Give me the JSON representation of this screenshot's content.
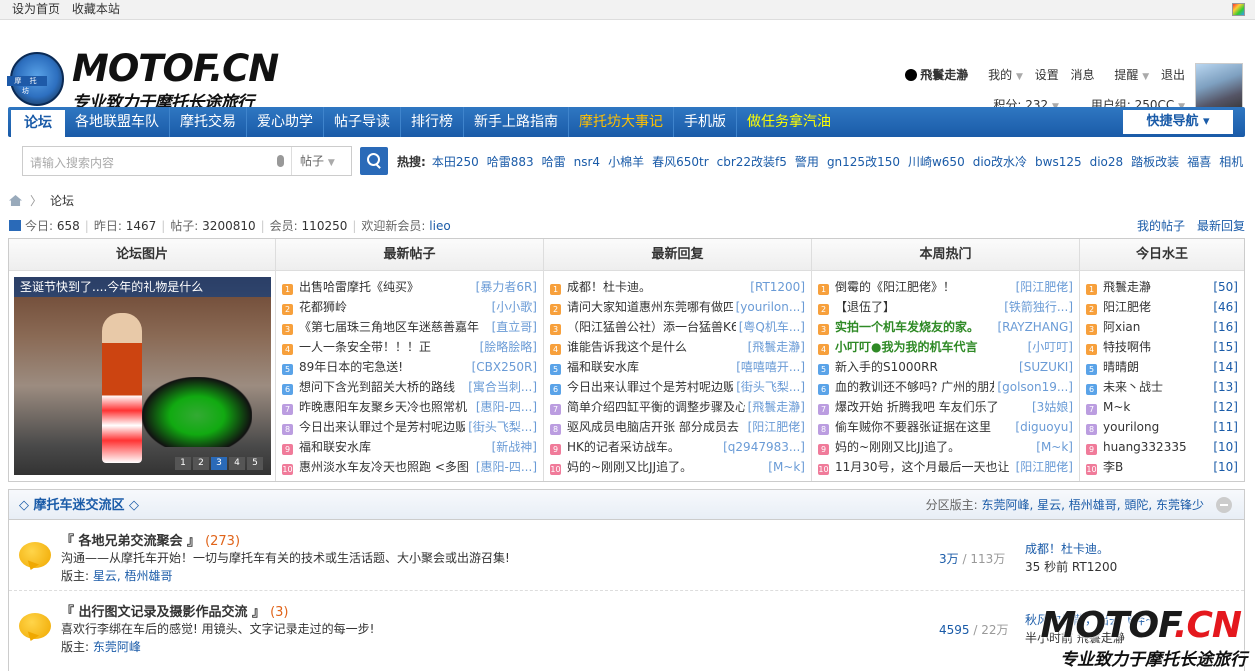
{
  "topbar": {
    "set_home": "设为首页",
    "bookmark": "收藏本站"
  },
  "logo": {
    "text": "MOTOF.CN",
    "subtitle": "专业致力于摩托长途旅行",
    "badge": "摩 托 坊"
  },
  "user": {
    "name": "飛鬟走瀞",
    "my": "我的",
    "settings": "设置",
    "messages": "消息",
    "reminders": "提醒",
    "logout": "退出",
    "points": "积分: 232",
    "group": "用户组: 250CC"
  },
  "nav": {
    "items": [
      "论坛",
      "各地联盟车队",
      "摩托交易",
      "爱心助学",
      "帖子导读",
      "排行榜",
      "新手上路指南",
      "摩托坊大事记",
      "手机版",
      "做任务拿汽油"
    ],
    "quick": "快捷导航"
  },
  "search": {
    "placeholder": "请输入搜索内容",
    "scope": "帖子",
    "hot_label": "热搜:",
    "hot": [
      "本田250",
      "哈雷883",
      "哈雷",
      "nsr4",
      "小棉羊",
      "春风650tr",
      "cbr22改装f5",
      "警用",
      "gn125改150",
      "川崎w650",
      "dio改水冷",
      "bws125",
      "dio28",
      "踏板改装",
      "福喜",
      "相机"
    ]
  },
  "breadcrumb": {
    "current": "论坛"
  },
  "stats": {
    "today_label": "今日:",
    "today": "658",
    "yesterday_label": "昨日:",
    "yesterday": "1467",
    "posts_label": "帖子:",
    "posts": "3200810",
    "members_label": "会员:",
    "members": "110250",
    "welcome_label": "欢迎新会员:",
    "new_member": "lieo",
    "my_posts": "我的帖子",
    "latest_reply": "最新回复"
  },
  "columns": {
    "pics": {
      "title": "论坛图片",
      "caption": "圣诞节快到了....今年的礼物是什么",
      "pages": [
        "1",
        "2",
        "3",
        "4",
        "5"
      ]
    },
    "newposts": {
      "title": "最新帖子",
      "items": [
        {
          "n": "1",
          "t": "出售哈雷摩托《纯买》",
          "a": "[暴力者6R]"
        },
        {
          "n": "2",
          "t": "花都狮岭",
          "a": "[小小歌]"
        },
        {
          "n": "3",
          "t": "《第七届珠三角地区车迷慈善嘉年",
          "a": "[直立哥]"
        },
        {
          "n": "4",
          "t": "一人一条安全带！！！正",
          "a": "[脍略脍略]"
        },
        {
          "n": "5",
          "t": "89年日本的宅急送!",
          "a": "[CBX250R]"
        },
        {
          "n": "6",
          "t": "想问下含光到韶关大桥的路线",
          "a": "[寓合当刺...]"
        },
        {
          "n": "7",
          "t": "昨晚惠阳车友聚乡天冷也照常机",
          "a": "[惠阳-四...]"
        },
        {
          "n": "8",
          "t": "今日出来认罪过个是芳村呢边贩",
          "a": "[街头飞梨...]"
        },
        {
          "n": "9",
          "t": "福和联安水库",
          "a": "[新战神]"
        },
        {
          "n": "10",
          "t": "惠州淡水车友冷天也照跑 <多图",
          "a": "[惠阳-四...]"
        }
      ]
    },
    "newreplies": {
      "title": "最新回复",
      "items": [
        {
          "n": "1",
          "t": "成都！杜卡迪。",
          "a": "[RT1200]"
        },
        {
          "n": "2",
          "t": "请问大家知道惠州东莞哪有做四",
          "a": "[yourilon...]"
        },
        {
          "n": "3",
          "t": "（阳江猛兽公社）添一台猛兽K6",
          "a": "[粤Q机车...]"
        },
        {
          "n": "4",
          "t": "谁能告诉我这个是什么",
          "a": "[飛鬟走瀞]"
        },
        {
          "n": "5",
          "t": "福和联安水库",
          "a": "[嘻嘻嘻开...]"
        },
        {
          "n": "6",
          "t": "今日出来认罪过个是芳村呢边贩",
          "a": "[街头飞梨...]"
        },
        {
          "n": "7",
          "t": "简单介绍四缸平衡的调整步骤及心",
          "a": "[飛鬟走瀞]"
        },
        {
          "n": "8",
          "t": "驱风成员电脑店开张 部分成员去",
          "a": "[阳江肥佬]"
        },
        {
          "n": "9",
          "t": "HK的记者采访战车。",
          "a": "[q2947983...]"
        },
        {
          "n": "10",
          "t": "妈的~刚刚又比JJ追了。",
          "a": "[M~k]"
        }
      ]
    },
    "hot": {
      "title": "本周热门",
      "items": [
        {
          "n": "1",
          "t": "倒霉的《阳江肥佬》！",
          "a": "[阳江肥佬]",
          "g": false
        },
        {
          "n": "2",
          "t": "【退伍了】",
          "a": "[铁箭独行...]",
          "g": false
        },
        {
          "n": "3",
          "t": "实拍一个机车发烧友的家。",
          "a": "[RAYZHANG]",
          "g": true
        },
        {
          "n": "4",
          "t": "小叮叮●我为我的机车代言",
          "a": "[小叮叮]",
          "g": true
        },
        {
          "n": "5",
          "t": "新入手的S1000RR",
          "a": "[SUZUKI]",
          "g": false
        },
        {
          "n": "6",
          "t": "血的教训还不够吗? 广州的朋友",
          "a": "[golson19...]",
          "g": false
        },
        {
          "n": "7",
          "t": "爆改开始 折腾我吧 车友们乐了",
          "a": "[3姑娘]",
          "g": false
        },
        {
          "n": "8",
          "t": "偷车贼你不要器张证据在这里",
          "a": "[diguoyu]",
          "g": false
        },
        {
          "n": "9",
          "t": "妈的~刚刚又比JJ追了。",
          "a": "[M~k]",
          "g": false
        },
        {
          "n": "10",
          "t": "11月30号，这个月最后一天也让",
          "a": "[阳江肥佬]",
          "g": false
        }
      ]
    },
    "kings": {
      "title": "今日水王",
      "items": [
        {
          "n": "1",
          "t": "飛鬟走瀞",
          "c": "[50]"
        },
        {
          "n": "2",
          "t": "阳江肥佬",
          "c": "[46]"
        },
        {
          "n": "3",
          "t": "阿xian",
          "c": "[16]"
        },
        {
          "n": "4",
          "t": "特技啊伟",
          "c": "[15]"
        },
        {
          "n": "5",
          "t": "晴晴朗",
          "c": "[14]"
        },
        {
          "n": "6",
          "t": "未来丶战士",
          "c": "[13]"
        },
        {
          "n": "7",
          "t": "M~k",
          "c": "[12]"
        },
        {
          "n": "8",
          "t": "yourilong",
          "c": "[11]"
        },
        {
          "n": "9",
          "t": "huang332335",
          "c": "[10]"
        },
        {
          "n": "10",
          "t": "李B",
          "c": "[10]"
        }
      ]
    }
  },
  "section": {
    "title": "◇ 摩托车迷交流区 ◇",
    "mods_label": "分区版主:",
    "mods": "东莞阿峰, 星云, 梧州雄哥, 頭陀, 东莞锋少"
  },
  "forums": [
    {
      "name": "『 各地兄弟交流聚会 』",
      "count": "(273)",
      "desc": "沟通——从摩托车开始！一切与摩托车有关的技术或生活话题、大小聚会或出游召集!",
      "mod_label": "版主:",
      "mods": "星云, 梧州雄哥",
      "threads": "3万",
      "posts": "/ 113万",
      "last_title": "成都！杜卡迪。",
      "last_meta": "35 秒前 RT1200"
    },
    {
      "name": "『 出行图文记录及摄影作品交流 』",
      "count": "(3)",
      "desc": "喜欢行李绑在车后的感觉! 用镜头、文字记录走过的每一步!",
      "mod_label": "版主:",
      "mods": "东莞阿峰",
      "threads": "4595",
      "posts": "/ 22万",
      "last_title": "秋风吹云散，出去飞奔~",
      "last_meta": "半小时前 飛鬟走瀞"
    }
  ],
  "watermark": {
    "text_a": "MOTOF",
    "text_b": ".CN",
    "sub": "专业致力于摩托长途旅行"
  }
}
